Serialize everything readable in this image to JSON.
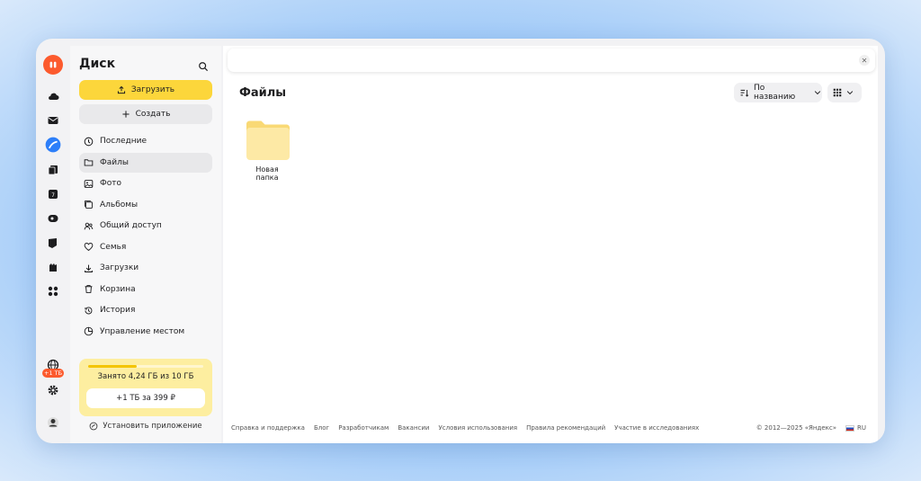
{
  "sidebar": {
    "title": "Диск",
    "upload_label": "Загрузить",
    "create_label": "Создать",
    "items": [
      {
        "label": "Последние",
        "icon": "clock-icon"
      },
      {
        "label": "Файлы",
        "icon": "folder-icon",
        "active": true
      },
      {
        "label": "Фото",
        "icon": "photo-icon"
      },
      {
        "label": "Альбомы",
        "icon": "album-icon"
      },
      {
        "label": "Общий доступ",
        "icon": "users-icon"
      },
      {
        "label": "Семья",
        "icon": "heart-icon"
      },
      {
        "label": "Загрузки",
        "icon": "download-icon"
      },
      {
        "label": "Корзина",
        "icon": "trash-icon"
      },
      {
        "label": "История",
        "icon": "history-icon"
      },
      {
        "label": "Управление местом",
        "icon": "storage-icon"
      }
    ],
    "storage": {
      "used_text": "Занято 4,24 ГБ из 10 ГБ",
      "used_fraction": 0.424,
      "offer_label": "+1 ТБ за 399 ₽"
    },
    "install_label": "Установить приложение"
  },
  "rail": {
    "badge": "+1 ТБ"
  },
  "main": {
    "title": "Файлы",
    "sort_label": "По названию",
    "folders": [
      {
        "name": "Новая папка"
      }
    ]
  },
  "footer": {
    "links": [
      "Справка и поддержка",
      "Блог",
      "Разработчикам",
      "Вакансии",
      "Условия использования",
      "Правила рекомендаций",
      "Участие в исследованиях"
    ],
    "copyright": "© 2012—2025 «Яндекс»",
    "lang": "RU"
  },
  "colors": {
    "accent_yellow": "#fcd63b",
    "brand_orange": "#fc5a2d",
    "disk_blue": "#2d7ff9"
  }
}
